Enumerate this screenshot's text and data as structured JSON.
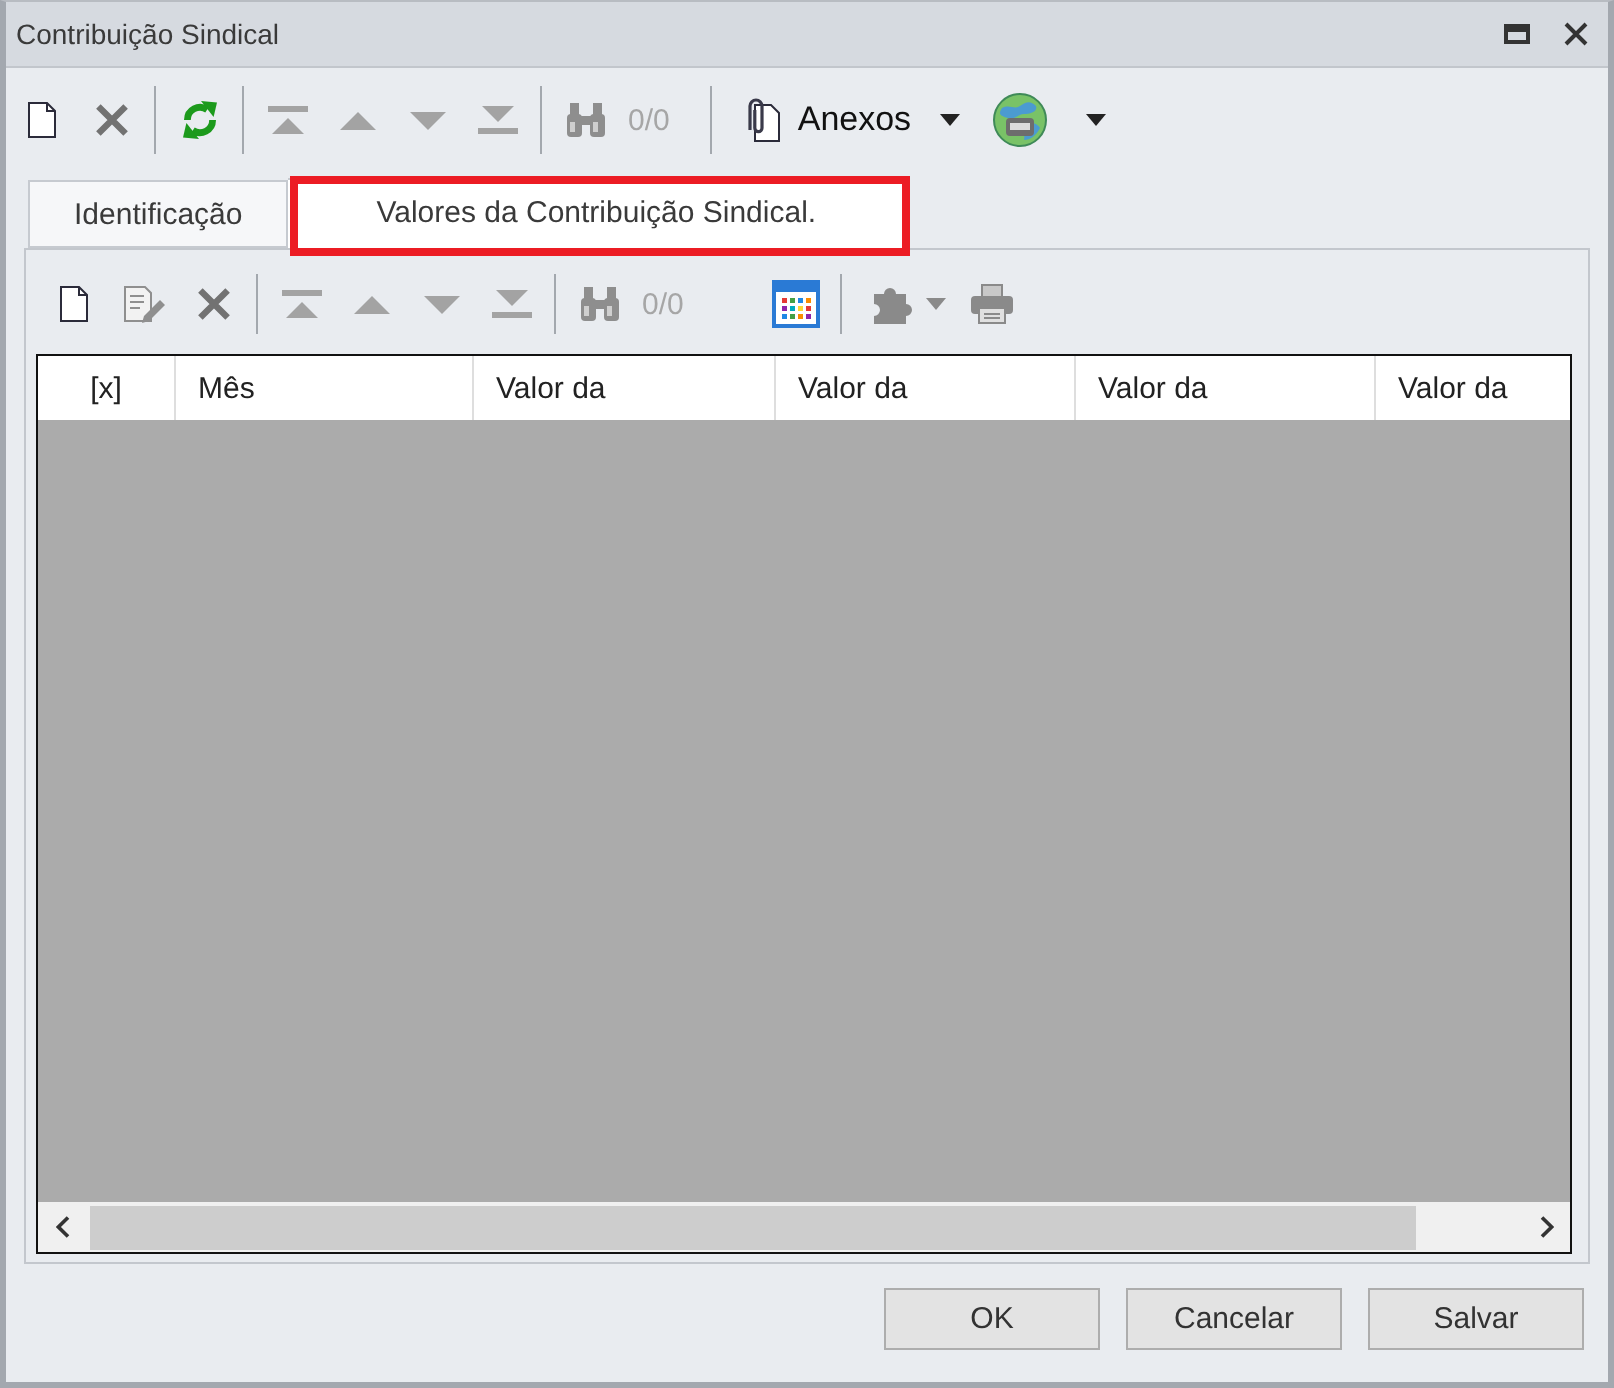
{
  "window": {
    "title": "Contribuição Sindical"
  },
  "toolbar": {
    "groups": [
      [
        {
          "kind": "new",
          "disabled": false
        },
        {
          "kind": "delete",
          "disabled": false
        }
      ],
      [
        {
          "kind": "refresh",
          "disabled": false
        }
      ],
      [
        {
          "kind": "first",
          "disabled": true
        },
        {
          "kind": "previous",
          "disabled": true
        },
        {
          "kind": "next",
          "disabled": true
        },
        {
          "kind": "last",
          "disabled": true
        }
      ],
      [
        {
          "kind": "find",
          "disabled": true
        },
        {
          "kind": "counter",
          "text": "0/0",
          "disabled": true
        }
      ],
      [
        {
          "kind": "attachments",
          "label": "Anexos",
          "disabled": false
        },
        {
          "kind": "web",
          "disabled": false
        }
      ]
    ]
  },
  "tabs": [
    {
      "label": "Identificação",
      "selected": false,
      "highlighted": false
    },
    {
      "label": "Valores da Contribuição Sindical.",
      "selected": true,
      "highlighted": true
    }
  ],
  "panel": {
    "toolbar": {
      "groups": [
        [
          {
            "kind": "new",
            "disabled": false
          },
          {
            "kind": "edit",
            "disabled": true
          },
          {
            "kind": "delete",
            "disabled": false
          }
        ],
        [
          {
            "kind": "first",
            "disabled": true
          },
          {
            "kind": "previous",
            "disabled": true
          },
          {
            "kind": "next",
            "disabled": true
          },
          {
            "kind": "last",
            "disabled": true
          }
        ],
        [
          {
            "kind": "find",
            "disabled": true
          },
          {
            "kind": "counter",
            "text": "0/0",
            "disabled": true
          },
          {
            "kind": "colors",
            "disabled": false
          }
        ],
        [
          {
            "kind": "tools",
            "disabled": true
          },
          {
            "kind": "print",
            "disabled": true
          }
        ]
      ]
    },
    "table": {
      "columns": [
        "[x]",
        "Mês",
        "Valor da",
        "Valor da",
        "Valor da",
        "Valor da"
      ]
    }
  },
  "buttons": [
    "OK",
    "Cancelar",
    "Salvar"
  ]
}
